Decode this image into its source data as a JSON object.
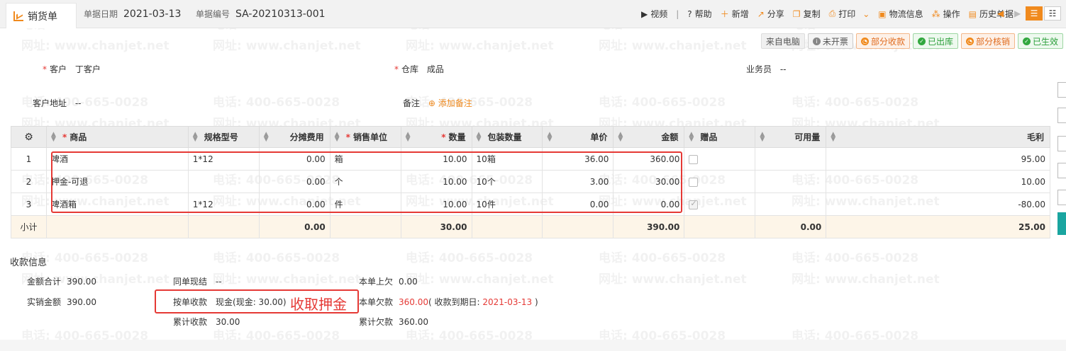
{
  "tab": {
    "label": "销货单"
  },
  "header": {
    "date_label": "单据日期",
    "date_value": "2021-03-13",
    "no_label": "单据编号",
    "no_value": "SA-20210313-001"
  },
  "toolbar": {
    "video": "视频",
    "help": "帮助",
    "add": "新增",
    "share": "分享",
    "copy": "复制",
    "print": "打印",
    "logistics": "物流信息",
    "ops": "操作",
    "history": "历史单据"
  },
  "badges": {
    "source": "来自电脑",
    "invoice": "未开票",
    "receipt": "部分收款",
    "outbound": "已出库",
    "verify": "部分核销",
    "effective": "已生效"
  },
  "form": {
    "customer_label": "客户",
    "customer_value": "丁客户",
    "warehouse_label": "仓库",
    "warehouse_value": "成品",
    "salesman_label": "业务员",
    "salesman_value": "--",
    "address_label": "客户地址",
    "address_value": "--",
    "note_label": "备注",
    "note_add": "添加备注"
  },
  "table": {
    "headers": [
      "商品",
      "规格型号",
      "分摊费用",
      "销售单位",
      "数量",
      "包装数量",
      "单价",
      "金额",
      "赠品",
      "可用量",
      "毛利"
    ],
    "rows": [
      {
        "no": "1",
        "item": "啤酒",
        "spec": "1*12",
        "cost": "0.00",
        "unit": "箱",
        "qty": "10.00",
        "pack": "10箱",
        "price": "36.00",
        "amount": "360.00",
        "gift": false,
        "avail": "",
        "profit": "95.00"
      },
      {
        "no": "2",
        "item": "押金-可退",
        "spec": "",
        "cost": "0.00",
        "unit": "个",
        "qty": "10.00",
        "pack": "10个",
        "price": "3.00",
        "amount": "30.00",
        "gift": false,
        "avail": "",
        "profit": "10.00"
      },
      {
        "no": "3",
        "item": "啤酒箱",
        "spec": "1*12",
        "cost": "0.00",
        "unit": "件",
        "qty": "10.00",
        "pack": "10件",
        "price": "0.00",
        "amount": "0.00",
        "gift": true,
        "avail": "",
        "profit": "-80.00"
      }
    ],
    "subtotal": {
      "label": "小计",
      "cost": "0.00",
      "qty": "30.00",
      "amount": "390.00",
      "avail": "0.00",
      "profit": "25.00"
    }
  },
  "payment": {
    "title": "收款信息",
    "total_label": "金额合计",
    "total_value": "390.00",
    "actual_label": "实销金额",
    "actual_value": "390.00",
    "settle_label": "同单现结",
    "settle_value": "--",
    "by_order_label": "按单收款",
    "by_order_value": "现金(现金: 30.00)",
    "cum_label": "累计收款",
    "cum_value": "30.00",
    "prev_owe_label": "本单上欠",
    "prev_owe_value": "0.00",
    "owe_label": "本单欠款",
    "owe_value": "360.00",
    "owe_due_prefix": "( 收款到期日: ",
    "owe_due_date": "2021-03-13",
    "owe_due_suffix": " )",
    "cum_owe_label": "累计欠款",
    "cum_owe_value": "360.00"
  },
  "annotation": "收取押金",
  "watermark": {
    "phone": "电话: 400-665-0028",
    "site": "网址: www.chanjet.net"
  },
  "colors": {
    "accent": "#f08a1e",
    "highlight": "#e53935",
    "success": "#32a83f"
  }
}
